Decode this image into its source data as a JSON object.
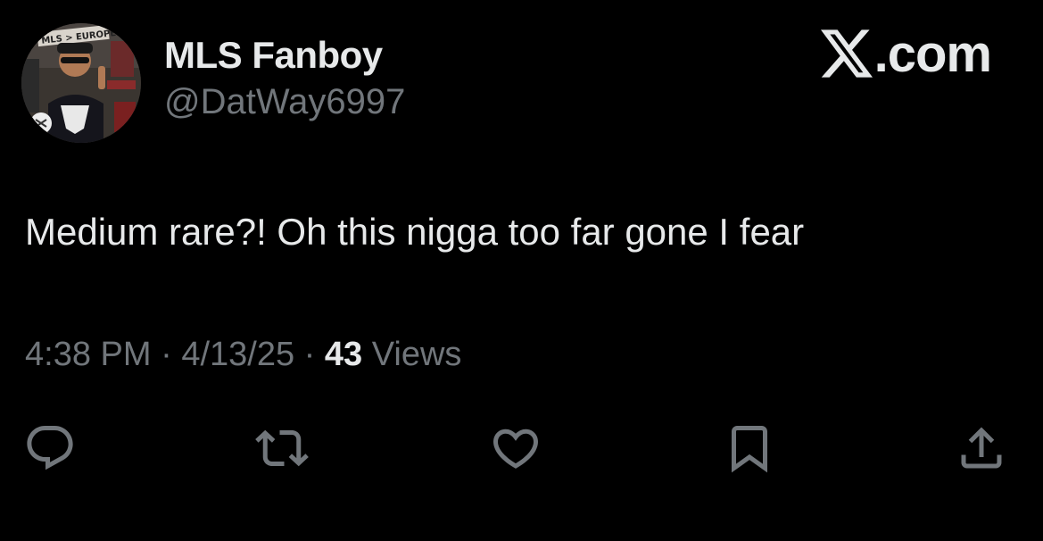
{
  "tweet": {
    "author": {
      "display_name": "MLS Fanboy",
      "handle": "@DatWay6997",
      "avatar_banner_text": "MLS > EUROPE"
    },
    "brand": {
      "icon": "x-logo-icon",
      "suffix": ".com"
    },
    "text": "Medium rare?! Oh this nigga too far gone I fear",
    "meta": {
      "time": "4:38 PM",
      "separator": "·",
      "date": "4/13/25",
      "views_count": "43",
      "views_label": "Views"
    },
    "actions": [
      {
        "name": "reply",
        "icon": "reply-icon"
      },
      {
        "name": "repost",
        "icon": "repost-icon"
      },
      {
        "name": "like",
        "icon": "heart-icon"
      },
      {
        "name": "bookmark",
        "icon": "bookmark-icon"
      },
      {
        "name": "share",
        "icon": "share-icon"
      }
    ],
    "colors": {
      "background": "#000000",
      "primary_text": "#e7e9ea",
      "secondary_text": "#71767b"
    }
  }
}
